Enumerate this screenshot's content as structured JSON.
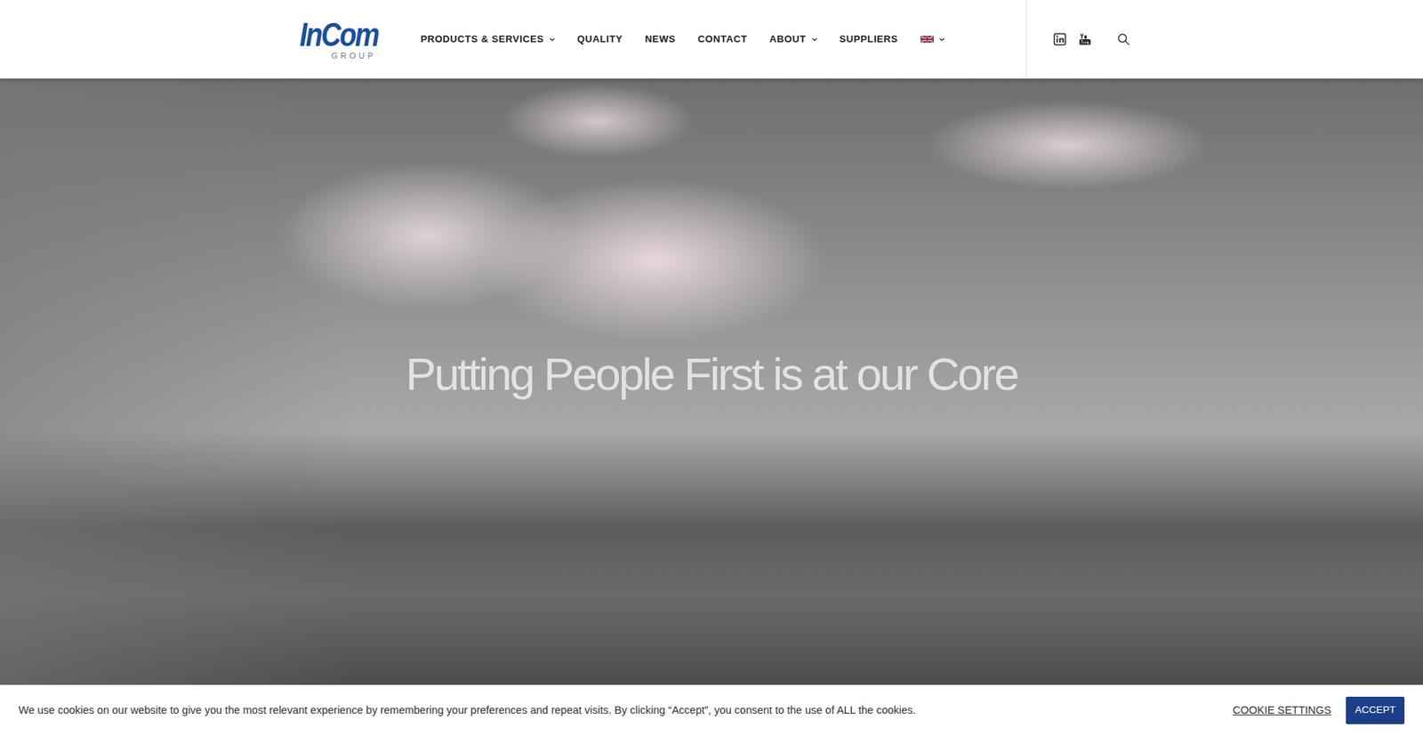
{
  "logo": {
    "name": "InCom",
    "sub": "GROUP"
  },
  "nav": [
    {
      "label": "PRODUCTS & SERVICES",
      "dropdown": true
    },
    {
      "label": "QUALITY",
      "dropdown": false
    },
    {
      "label": "NEWS",
      "dropdown": false
    },
    {
      "label": "CONTACT",
      "dropdown": false
    },
    {
      "label": "ABOUT",
      "dropdown": true
    },
    {
      "label": "SUPPLIERS",
      "dropdown": false
    }
  ],
  "language": {
    "dropdown": true
  },
  "hero": {
    "title": "Putting People First is at our Core"
  },
  "cookie": {
    "text": "We use cookies on our website to give you the most relevant experience by remembering your preferences and repeat visits. By clicking “Accept”, you consent to the use of ALL the cookies.",
    "settings": "COOKIE SETTINGS",
    "accept": "ACCEPT"
  }
}
